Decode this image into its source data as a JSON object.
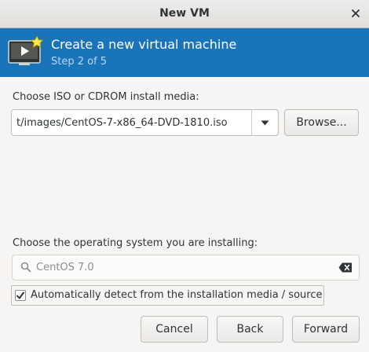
{
  "window": {
    "title": "New VM"
  },
  "banner": {
    "heading": "Create a new virtual machine",
    "step": "Step 2 of 5"
  },
  "media": {
    "label": "Choose ISO or CDROM install media:",
    "path_value": "t/images/CentOS-7-x86_64-DVD-1810.iso",
    "browse_label": "Browse..."
  },
  "os": {
    "label": "Choose the operating system you are installing:",
    "search_value": "CentOS 7.0",
    "auto_detect_label": "Automatically detect from the installation media / source",
    "auto_detect_checked": true
  },
  "footer": {
    "cancel_label": "Cancel",
    "back_label": "Back",
    "forward_label": "Forward"
  },
  "colors": {
    "banner": "#1a74b9",
    "step_text": "#b5d7f3"
  },
  "icons": [
    "close-icon",
    "vm-screen-icon",
    "dropdown-arrow-icon",
    "search-icon",
    "clear-text-icon",
    "checkmark-icon"
  ]
}
